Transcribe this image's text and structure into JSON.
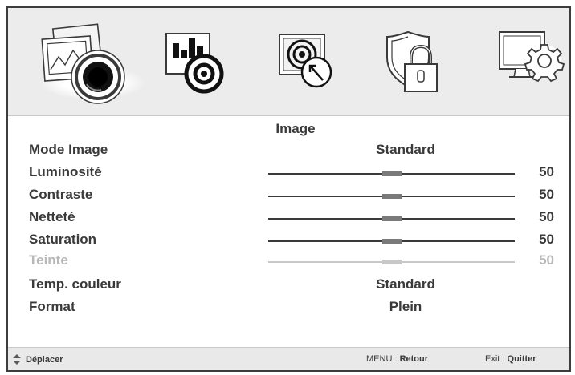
{
  "tabs": [
    {
      "icon": "picture-icon",
      "selected": true
    },
    {
      "icon": "sound-icon",
      "selected": false
    },
    {
      "icon": "channel-icon",
      "selected": false
    },
    {
      "icon": "lock-icon",
      "selected": false
    },
    {
      "icon": "setup-icon",
      "selected": false
    }
  ],
  "menu": {
    "title": "Image",
    "rows": [
      {
        "label": "Mode Image",
        "value": "Standard"
      },
      {
        "label": "Luminosité",
        "level": 50,
        "value": "50"
      },
      {
        "label": "Contraste",
        "level": 50,
        "value": "50"
      },
      {
        "label": "Netteté",
        "level": 50,
        "value": "50"
      },
      {
        "label": "Saturation",
        "level": 50,
        "value": "50"
      },
      {
        "label": "Teinte",
        "level": 50,
        "value": "50",
        "disabled": true
      },
      {
        "label": "Temp. couleur",
        "value": "Standard"
      },
      {
        "label": "Format",
        "value": "Plein"
      }
    ]
  },
  "footer": {
    "nav_label": "Déplacer",
    "menu_key": "MENU :",
    "menu_action": "Retour",
    "exit_key": "Exit :",
    "exit_action": "Quitter"
  },
  "colors": {
    "text": "#3a3a3a",
    "disabled_text": "#b8b8b8",
    "header_bg": "#ececec",
    "border": "#3d3d3d"
  }
}
